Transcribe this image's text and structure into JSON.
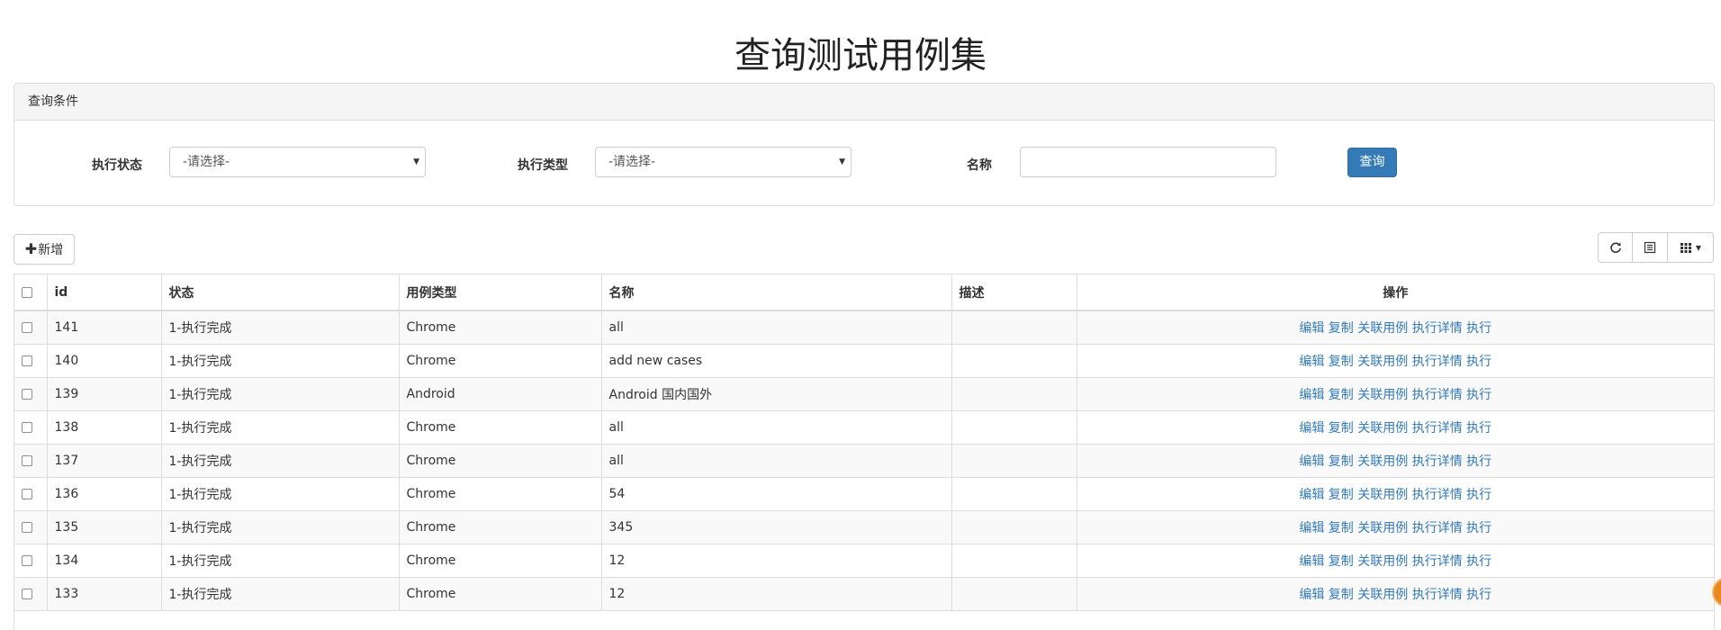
{
  "page": {
    "title": "查询测试用例集"
  },
  "filter": {
    "heading": "查询条件",
    "status_label": "执行状态",
    "status_value": "-请选择-",
    "type_label": "执行类型",
    "type_value": "-请选择-",
    "name_label": "名称",
    "name_value": "",
    "query_button": "查询"
  },
  "toolbar": {
    "add_label": "新增",
    "icons": [
      "refresh-icon",
      "list-toggle-icon",
      "columns-icon"
    ]
  },
  "table": {
    "headers": [
      "id",
      "状态",
      "用例类型",
      "名称",
      "描述",
      "操作"
    ],
    "actions": [
      "编辑",
      "复制",
      "关联用例",
      "执行详情",
      "执行"
    ],
    "rows": [
      {
        "id": "141",
        "status": "1-执行完成",
        "type": "Chrome",
        "name": "all",
        "desc": ""
      },
      {
        "id": "140",
        "status": "1-执行完成",
        "type": "Chrome",
        "name": "add new cases",
        "desc": ""
      },
      {
        "id": "139",
        "status": "1-执行完成",
        "type": "Android",
        "name": "Android 国内国外",
        "desc": ""
      },
      {
        "id": "138",
        "status": "1-执行完成",
        "type": "Chrome",
        "name": "all",
        "desc": ""
      },
      {
        "id": "137",
        "status": "1-执行完成",
        "type": "Chrome",
        "name": "all",
        "desc": ""
      },
      {
        "id": "136",
        "status": "1-执行完成",
        "type": "Chrome",
        "name": "54",
        "desc": ""
      },
      {
        "id": "135",
        "status": "1-执行完成",
        "type": "Chrome",
        "name": "345",
        "desc": ""
      },
      {
        "id": "134",
        "status": "1-执行完成",
        "type": "Chrome",
        "name": "12",
        "desc": ""
      },
      {
        "id": "133",
        "status": "1-执行完成",
        "type": "Chrome",
        "name": "12",
        "desc": ""
      }
    ]
  },
  "colors": {
    "primary": "#337ab7",
    "link": "#337ab7",
    "stripe": "#f9f9f9"
  }
}
